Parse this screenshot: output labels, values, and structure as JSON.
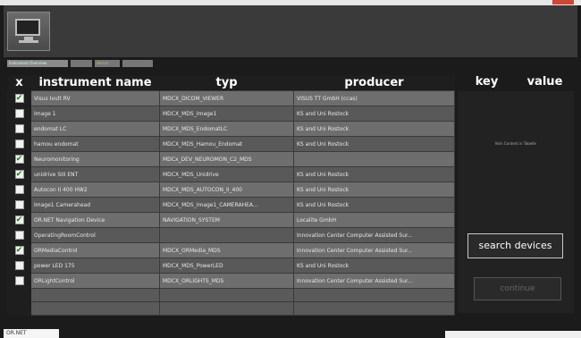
{
  "tabs": [
    "Instrument Overview",
    "",
    "device",
    ""
  ],
  "table": {
    "headers": [
      "x",
      "instrument name",
      "typ",
      "producer"
    ],
    "rows": [
      {
        "checked": true,
        "name": "Visus Ivult RV",
        "typ": "MDCX_DICOM_VIEWER",
        "producer": "VISUS TT GmbH (ccas)"
      },
      {
        "checked": false,
        "name": "Image 1",
        "typ": "MDCX_MDS_Image1",
        "producer": "KS and Uni Rostock"
      },
      {
        "checked": false,
        "name": "endomat LC",
        "typ": "MDCX_MDS_EndomatLC",
        "producer": "KS and Uni Rostock"
      },
      {
        "checked": false,
        "name": "hamou endomat",
        "typ": "MDCX_MDS_Hamou_Endomat",
        "producer": "KS and Uni Rostock"
      },
      {
        "checked": true,
        "name": "Neuromonitoring",
        "typ": "MDCx_DEV_NEUROMON_C2_MDS",
        "producer": ""
      },
      {
        "checked": true,
        "name": "unidrive SIII ENT",
        "typ": "MDCX_MDS_Unidrive",
        "producer": "KS and Uni Rostock"
      },
      {
        "checked": false,
        "name": "Autocon II 400 HW2",
        "typ": "MDCX_MDS_AUTOCON_II_400",
        "producer": "KS and Uni Rostock"
      },
      {
        "checked": false,
        "name": "Image1 Camerahead",
        "typ": "MDCX_MDS_Image1_CAMERAHEA...",
        "producer": "KS and Uni Rostock"
      },
      {
        "checked": true,
        "name": "OR.NET Navigation Device",
        "typ": "NAVIGATION_SYSTEM",
        "producer": "Localite GmbH"
      },
      {
        "checked": false,
        "name": "OperatingRoomControl",
        "typ": "",
        "producer": "Innovation Center Computer Assisted Sur..."
      },
      {
        "checked": true,
        "name": "ORMediaControl",
        "typ": "MDCX_ORMedia_MDS",
        "producer": "Innovation Center Computer Assisted Sur..."
      },
      {
        "checked": false,
        "name": "power LED 175",
        "typ": "MDCX_MDS_PowerLED",
        "producer": "KS and Uni Rostock"
      },
      {
        "checked": false,
        "name": "ORLightControl",
        "typ": "MDCX_ORLIGHTS_MDS",
        "producer": "Innovation Center Computer Assisted Sur..."
      }
    ]
  },
  "kv": {
    "key_label": "key",
    "value_label": "value",
    "empty_text": "Kein Content in Tabelle"
  },
  "buttons": {
    "search": "search devices",
    "continue": "continue"
  },
  "taskbar": {
    "left": "OR.NET",
    "right": ""
  },
  "colors": {
    "background": "#1b1b1b",
    "row_odd": "#6e6e6e",
    "row_even": "#595959",
    "check": "#1a7a1a"
  }
}
